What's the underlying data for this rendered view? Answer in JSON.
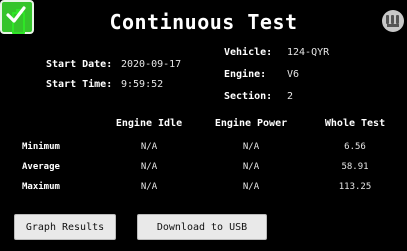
{
  "header": {
    "title": "Continuous Test",
    "battery_icon": "battery-icon",
    "logo_icon": "brand-logo-icon",
    "battery_color": "#2ee626"
  },
  "info": {
    "start_date_label": "Start Date:",
    "start_date_value": "2020-09-17",
    "start_time_label": "Start Time:",
    "start_time_value": "9:59:52",
    "vehicle_label": "Vehicle:",
    "vehicle_value": "124-QYR",
    "engine_label": "Engine:",
    "engine_value": "V6",
    "section_label": "Section:",
    "section_value": "2"
  },
  "stats": {
    "columns": [
      "Engine Idle",
      "Engine Power",
      "Whole Test"
    ],
    "rows": [
      {
        "label": "Minimum",
        "values": [
          "N/A",
          "N/A",
          "6.56"
        ]
      },
      {
        "label": "Average",
        "values": [
          "N/A",
          "N/A",
          "58.91"
        ]
      },
      {
        "label": "Maximum",
        "values": [
          "N/A",
          "N/A",
          "113.25"
        ]
      }
    ]
  },
  "buttons": {
    "graph_results": "Graph Results",
    "download_usb": "Download to USB",
    "confirm_icon": "checkmark-icon",
    "confirm_color": "#35c42b"
  }
}
